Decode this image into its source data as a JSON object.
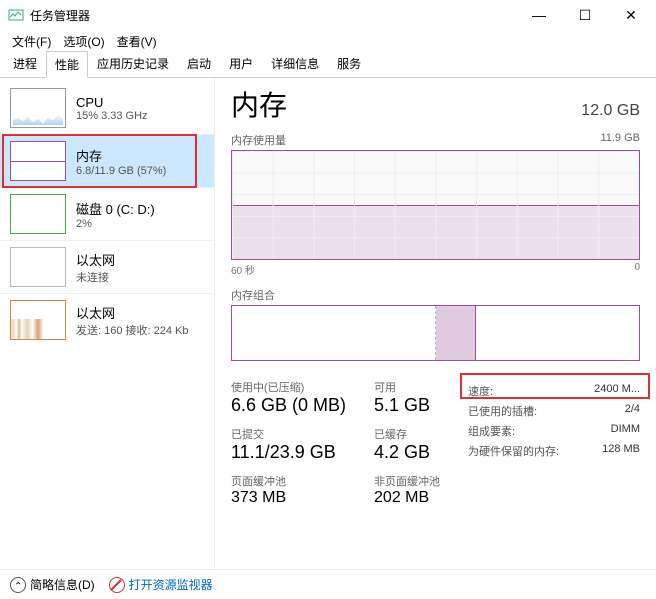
{
  "window": {
    "title": "任务管理器",
    "minimize": "—",
    "maximize": "☐",
    "close": "✕"
  },
  "menu": {
    "file": "文件(F)",
    "options": "选项(O)",
    "view": "查看(V)"
  },
  "tabs": {
    "processes": "进程",
    "performance": "性能",
    "app_history": "应用历史记录",
    "startup": "启动",
    "users": "用户",
    "details": "详细信息",
    "services": "服务"
  },
  "sidebar": {
    "cpu": {
      "name": "CPU",
      "sub": "15% 3.33 GHz"
    },
    "memory": {
      "name": "内存",
      "sub": "6.8/11.9 GB (57%)"
    },
    "disk": {
      "name": "磁盘 0 (C: D:)",
      "sub": "2%"
    },
    "eth1": {
      "name": "以太网",
      "sub": "未连接"
    },
    "eth2": {
      "name": "以太网",
      "sub": "发送: 160 接收: 224 Kb"
    }
  },
  "main": {
    "title": "内存",
    "capacity": "12.0 GB",
    "usage_label": "内存使用量",
    "usage_max": "11.9 GB",
    "x_left": "60 秒",
    "x_right": "0",
    "comp_label": "内存组合",
    "stats": {
      "in_use_label": "使用中(已压缩)",
      "in_use_value": "6.6 GB (0 MB)",
      "available_label": "可用",
      "available_value": "5.1 GB",
      "committed_label": "已提交",
      "committed_value": "11.1/23.9 GB",
      "cached_label": "已缓存",
      "cached_value": "4.2 GB",
      "paged_label": "页面缓冲池",
      "paged_value": "373 MB",
      "nonpaged_label": "非页面缓冲池",
      "nonpaged_value": "202 MB"
    },
    "info": {
      "speed_k": "速度:",
      "speed_v": "2400 M...",
      "slots_k": "已使用的插槽:",
      "slots_v": "2/4",
      "form_k": "组成要素:",
      "form_v": "DIMM",
      "reserved_k": "为硬件保留的内存:",
      "reserved_v": "128 MB"
    }
  },
  "footer": {
    "fewer": "简略信息(D)",
    "resmon": "打开资源监视器"
  },
  "chart_data": {
    "type": "area",
    "title": "内存使用量",
    "xlabel": "60 秒",
    "ylabel": "GB",
    "ylim": [
      0,
      11.9
    ],
    "x_range_seconds": [
      60,
      0
    ],
    "series": [
      {
        "name": "使用中",
        "approx_constant_value": 6.8
      }
    ],
    "composition": {
      "in_use_gb": 6.6,
      "compressed_mb": 0,
      "modified_approx_gb": 1.1,
      "standby_cached_gb": 4.2,
      "free_approx_gb": 0.0,
      "total_gb": 11.9
    }
  }
}
